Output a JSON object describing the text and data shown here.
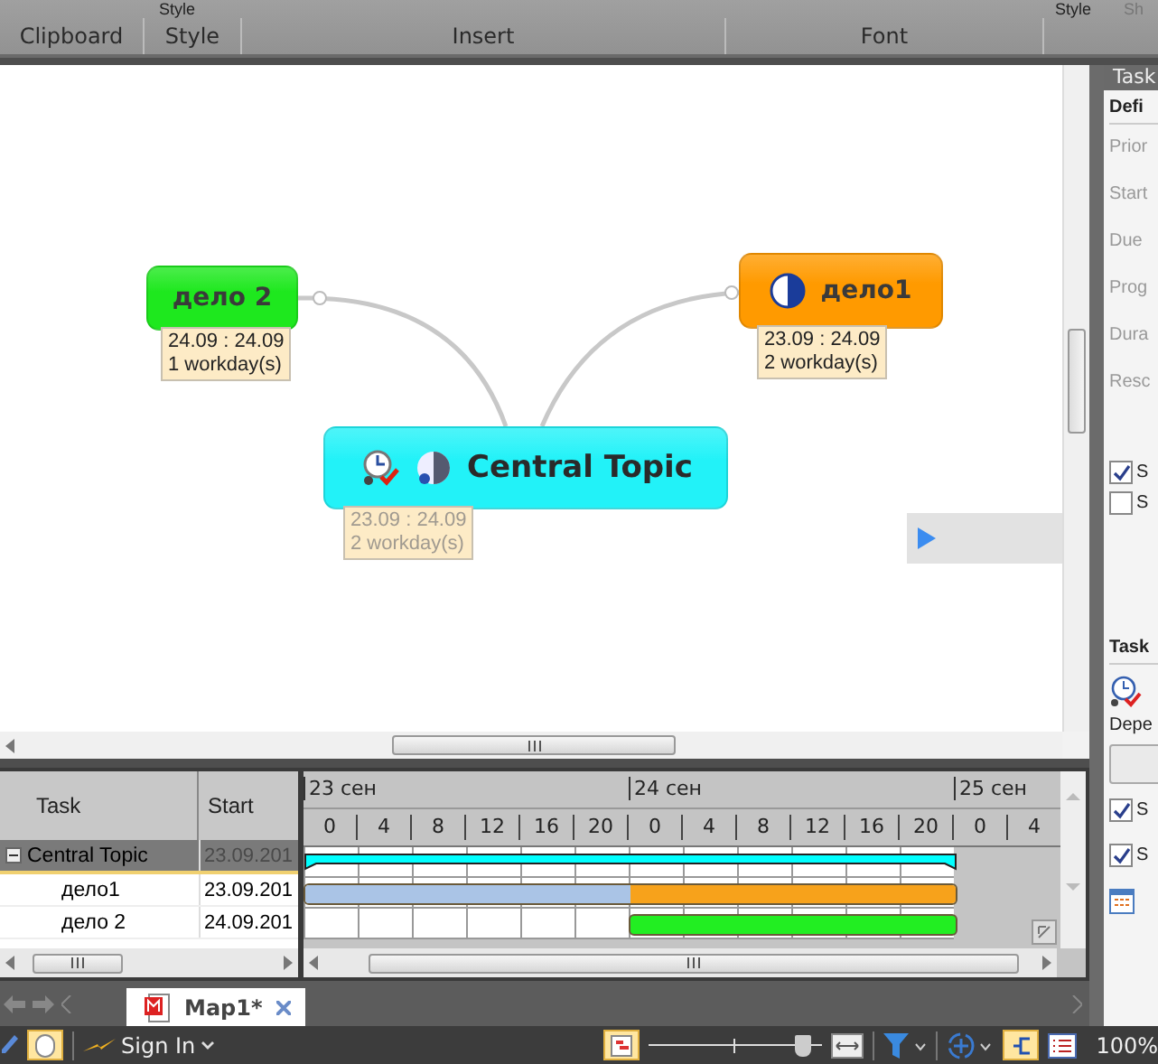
{
  "ribbon": {
    "top_labels": [
      {
        "label": "Style"
      },
      {
        "label": "Style"
      },
      {
        "label": "Sh"
      }
    ],
    "groups": [
      {
        "label": "Clipboard"
      },
      {
        "label": "Style"
      },
      {
        "label": "Insert"
      },
      {
        "label": "Font"
      }
    ]
  },
  "map": {
    "nodes": [
      {
        "kind": "topic",
        "label": "дело 2",
        "color": "#1ee81e",
        "dates": "24.09 : 24.09",
        "workdays": "1 workday(s)",
        "muted": false
      },
      {
        "kind": "topic",
        "label": "дело1",
        "color": "#ff9a00",
        "dates": "23.09 : 24.09",
        "workdays": "2 workday(s)",
        "muted": false
      },
      {
        "kind": "central",
        "label": "Central Topic",
        "color": "#22f2f8",
        "dates": "23.09 : 24.09",
        "workdays": "2 workday(s)",
        "muted": true
      }
    ]
  },
  "gantt": {
    "columns": [
      {
        "label": "Task"
      },
      {
        "label": "Start"
      }
    ],
    "rows": [
      {
        "task": "Central Topic",
        "start": "23.09.201",
        "selected": true,
        "expanded": true,
        "bar": {
          "kind": "summary",
          "color": "#00ffff"
        },
        "children": [
          {
            "task": "дело1",
            "start": "23.09.201",
            "selected": false,
            "bar": {
              "kind": "split",
              "segments": [
                {
                  "color": "#aac4e6"
                },
                {
                  "color": "#f7a21b"
                }
              ]
            }
          },
          {
            "task": "дело 2",
            "start": "24.09.201",
            "selected": false,
            "bar": {
              "kind": "task",
              "color": "#22ee22"
            }
          }
        ]
      }
    ],
    "days": [
      "23 сен",
      "24 сен",
      "25 сен"
    ],
    "hours": [
      "0",
      "4",
      "8",
      "12",
      "16",
      "20",
      "0",
      "4",
      "8",
      "12",
      "16",
      "20",
      "0",
      "4"
    ]
  },
  "tabs": [
    {
      "label": "Map1*",
      "selected": true
    }
  ],
  "task_panel": {
    "title": "Task",
    "section": "Defi",
    "fields": [
      "Prior",
      "Start",
      "Due",
      "Prog",
      "Dura",
      "Resc"
    ],
    "options": [
      {
        "label": "S",
        "checked": true
      },
      {
        "label": "S",
        "checked": false
      }
    ],
    "section_2": "Task",
    "dependency_label": "Depe",
    "options_2": [
      {
        "label": "S",
        "checked": true
      },
      {
        "label": "S",
        "checked": true
      }
    ]
  },
  "status_bar": {
    "sign_in": "Sign In",
    "zoom": {
      "level": 0.9
    },
    "zoom_text": "100%"
  }
}
